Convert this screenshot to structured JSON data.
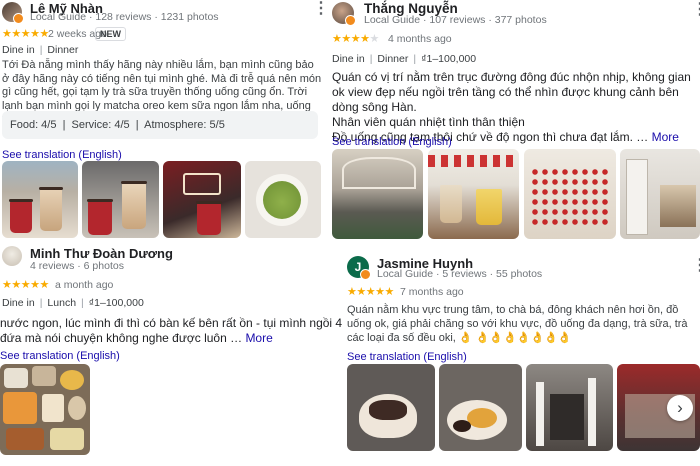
{
  "r1": {
    "name": "Lê Mỹ Nhàn",
    "meta": "Local Guide · 128 reviews · 1231 photos",
    "stars": "★★★★★",
    "when": "2 weeks ago",
    "badge": "NEW",
    "tags": [
      "Dine in",
      "Dinner"
    ],
    "text": "Tới Đà nẵng mình thấy hãng này nhiều lắm, bạn mình cũng bảo ở đây hãng này có tiếng nên tụi mình ghé. Mà đi trễ quá nên món gì cũng hết, gọi tạm ly trà sữa truyền thống uống cũng ổn. Trời lạnh bạn mình gọi ly matcha oreo kem sữa ngon lắm nha, uống thơm mà đậm vị thích lắm.",
    "ratings": "Food: 4/5  |  Service: 4/5  |  Atmosphere: 5/5",
    "translate": "See translation (English)"
  },
  "r2": {
    "name": "Thắng Nguyễn",
    "meta": "Local Guide · 107 reviews · 377 photos",
    "stars": "★★★★",
    "when": "4 months ago",
    "tags": [
      "Dine in",
      "Dinner",
      "₫1–100,000"
    ],
    "text1": "Quán có vị trí nằm trên trục đường đông đúc nhộn nhịp, không gian ok view đẹp nếu ngồi trên tầng có thể nhìn được khung cảnh bên dòng sông Hàn.",
    "text2": "Nhân viên quán nhiệt tình thân thiện",
    "text3": "Đồ uống cũng tạm thôi chứ về độ ngon thì chưa đạt lắm.",
    "more": "More",
    "translate": "See translation (English)"
  },
  "r3": {
    "name": "Minh Thư Đoàn Dương",
    "meta": "4 reviews · 6 photos",
    "stars": "★★★★★",
    "when": "a month ago",
    "tags": [
      "Dine in",
      "Lunch",
      "₫1–100,000"
    ],
    "text": "nước ngon, lúc mình đi thì có bàn kế bên rất ồn - tụi mình ngồi 4 đứa mà nói chuyện không nghe được luôn …",
    "more": "More",
    "translate": "See translation (English)"
  },
  "r4": {
    "initial": "J",
    "name": "Jasmine Huynh",
    "meta": "Local Guide · 5 reviews · 55 photos",
    "stars": "★★★★★",
    "when": "7 months ago",
    "text": "Quán nằm khu vực trung tâm, to chà bá, đông khách nên hơi ồn, đồ uống ok, giá phải chăng so với khu vực, đồ uống đa dạng, trà sữa, trà các loại đa số đều oki, 👌 👌👌👌👌👌👌👌",
    "translate": "See translation (English)"
  },
  "icons": {
    "menu": "more-vert-icon",
    "next": "chevron-right-icon"
  },
  "colors": {
    "star": "#f9ab00",
    "link": "#1a0dab",
    "local_guide_badge": "#f28b1d"
  }
}
